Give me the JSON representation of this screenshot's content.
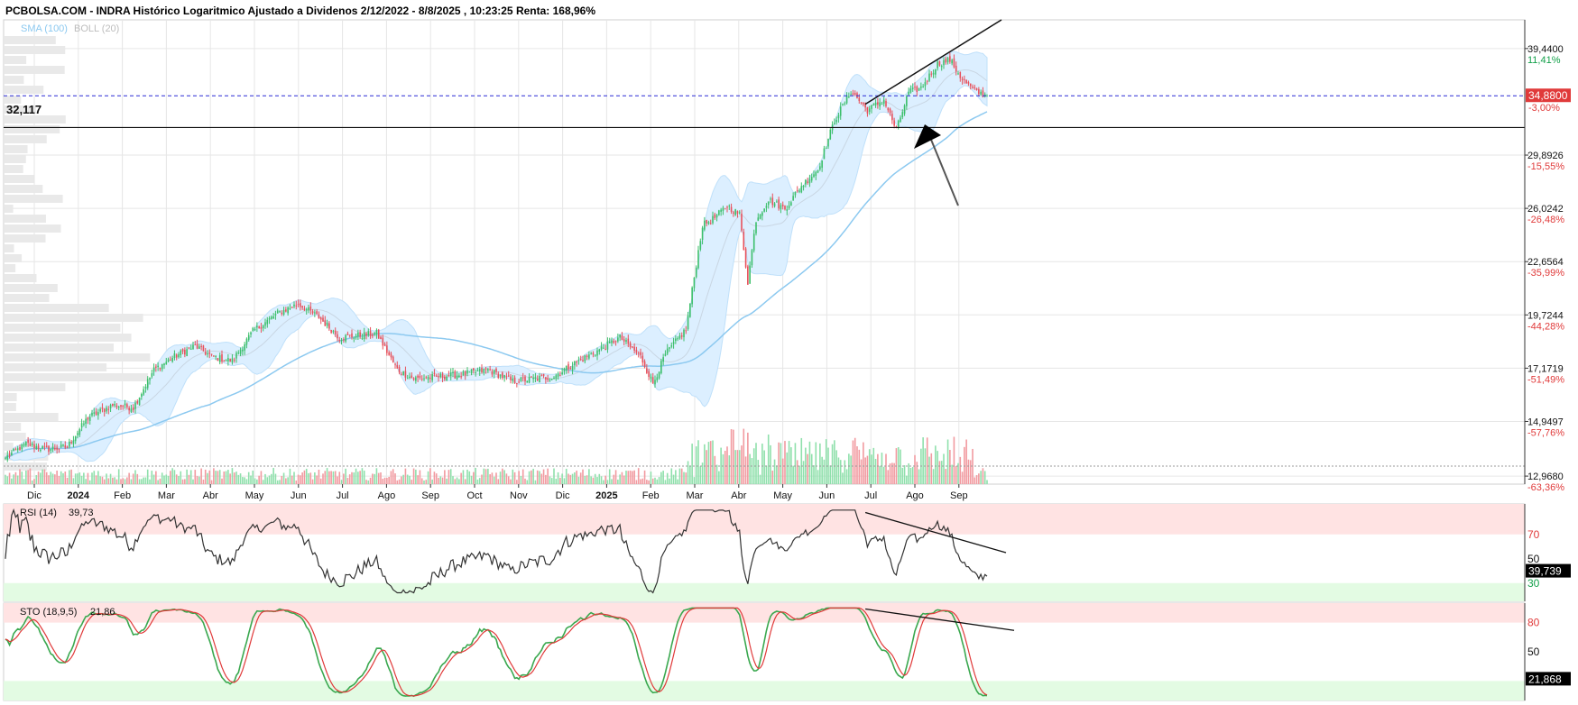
{
  "header": {
    "title": "PCBOLSA.COM - INDRA Histórico Logaritmico Ajustado a Dividenos 2/12/2022 - 8/8/2025 , 10:23:25 Renta: 168,96%"
  },
  "colors": {
    "up": "#3cbf6b",
    "down": "#e8505b",
    "vol_up": "#8fe0ac",
    "vol_down": "#f29aa0",
    "sma": "#8cc9f0",
    "boll_fill": "#dcefff",
    "grid": "#e6e6e6",
    "price_line": "#2a2ad6",
    "ob_zone": "#ffe3e3",
    "os_zone": "#e3fbe3",
    "rsi_line": "#333333",
    "sto_k": "#3aa84f",
    "sto_d": "#e03a3a",
    "red_text": "#e03a3a",
    "green_text": "#13a04a"
  },
  "legend": {
    "sma_label": "SMA (100)",
    "boll_label": "BOLL (20)"
  },
  "chart_data": {
    "type": "candlestick",
    "scale": "log",
    "price_axis": {
      "ticks": [
        {
          "value": 39.44,
          "label": "39,4400",
          "pct": "11,41%"
        },
        {
          "value": 29.8926,
          "label": "29,8926",
          "pct": "-15,55%"
        },
        {
          "value": 26.0242,
          "label": "26,0242",
          "pct": "-26,48%"
        },
        {
          "value": 22.6564,
          "label": "22,6564",
          "pct": "-35,99%"
        },
        {
          "value": 19.7244,
          "label": "19,7244",
          "pct": "-44,28%"
        },
        {
          "value": 17.1719,
          "label": "17,1719",
          "pct": "-51,49%"
        },
        {
          "value": 14.9497,
          "label": "14,9497",
          "pct": "-57,76%"
        },
        {
          "value": 12.968,
          "label": "12,9680",
          "pct": "-63,36%"
        }
      ],
      "range": [
        12.7,
        42.5
      ]
    },
    "current_price": {
      "value": 34.88,
      "label": "34,8800",
      "pct": "-3,00%"
    },
    "horizontal_level": {
      "value": 32.117,
      "label": "32,117"
    },
    "x_labels": [
      {
        "label": "Dic",
        "year": false
      },
      {
        "label": "2024",
        "year": true
      },
      {
        "label": "Feb",
        "year": false
      },
      {
        "label": "Mar",
        "year": false
      },
      {
        "label": "Abr",
        "year": false
      },
      {
        "label": "May",
        "year": false
      },
      {
        "label": "Jun",
        "year": false
      },
      {
        "label": "Jul",
        "year": false
      },
      {
        "label": "Ago",
        "year": false
      },
      {
        "label": "Sep",
        "year": false
      },
      {
        "label": "Oct",
        "year": false
      },
      {
        "label": "Nov",
        "year": false
      },
      {
        "label": "Dic",
        "year": false
      },
      {
        "label": "2025",
        "year": true
      },
      {
        "label": "Feb",
        "year": false
      },
      {
        "label": "Mar",
        "year": false
      },
      {
        "label": "Abr",
        "year": false
      },
      {
        "label": "May",
        "year": false
      },
      {
        "label": "Jun",
        "year": false
      },
      {
        "label": "Jul",
        "year": false
      },
      {
        "label": "Ago",
        "year": false
      },
      {
        "label": "Sep",
        "year": false
      }
    ],
    "close_anchors": [
      [
        0,
        13.6
      ],
      [
        10,
        14.1
      ],
      [
        20,
        13.9
      ],
      [
        30,
        14.0
      ],
      [
        40,
        15.1
      ],
      [
        52,
        15.6
      ],
      [
        62,
        15.5
      ],
      [
        72,
        17.1
      ],
      [
        82,
        17.7
      ],
      [
        92,
        18.2
      ],
      [
        100,
        17.7
      ],
      [
        110,
        17.5
      ],
      [
        120,
        18.9
      ],
      [
        132,
        19.8
      ],
      [
        142,
        20.3
      ],
      [
        152,
        19.6
      ],
      [
        162,
        18.6
      ],
      [
        172,
        18.7
      ],
      [
        180,
        18.8
      ],
      [
        190,
        17.1
      ],
      [
        198,
        16.7
      ],
      [
        210,
        16.8
      ],
      [
        222,
        16.9
      ],
      [
        234,
        17.1
      ],
      [
        246,
        16.6
      ],
      [
        256,
        16.7
      ],
      [
        266,
        16.8
      ],
      [
        276,
        17.4
      ],
      [
        286,
        17.9
      ],
      [
        298,
        18.6
      ],
      [
        308,
        17.7
      ],
      [
        314,
        16.5
      ],
      [
        320,
        17.8
      ],
      [
        330,
        19.0
      ],
      [
        338,
        24.9
      ],
      [
        344,
        25.4
      ],
      [
        350,
        26.2
      ],
      [
        356,
        25.6
      ],
      [
        360,
        21.5
      ],
      [
        364,
        25.3
      ],
      [
        370,
        26.6
      ],
      [
        378,
        26.0
      ],
      [
        386,
        27.6
      ],
      [
        394,
        28.8
      ],
      [
        402,
        32.7
      ],
      [
        410,
        35.3
      ],
      [
        418,
        33.6
      ],
      [
        426,
        34.5
      ],
      [
        432,
        31.9
      ],
      [
        438,
        35.2
      ],
      [
        444,
        35.6
      ],
      [
        452,
        37.9
      ],
      [
        458,
        38.3
      ],
      [
        464,
        36.4
      ],
      [
        470,
        35.3
      ],
      [
        476,
        34.88
      ]
    ],
    "bars": 477,
    "rsi": {
      "label": "RSI (14)",
      "value": "39,73",
      "value_box": "39,739",
      "levels": [
        {
          "value": 70,
          "label": "70"
        },
        {
          "value": 50,
          "label": "50"
        },
        {
          "value": 30,
          "label": "30"
        }
      ],
      "range": [
        15,
        95
      ]
    },
    "sto": {
      "label": "STO (18,9,5)",
      "value": "21,86",
      "value_box": "21,868",
      "levels": [
        {
          "value": 80,
          "label": "80"
        },
        {
          "value": 50,
          "label": "50"
        }
      ],
      "range": [
        0,
        100
      ]
    }
  }
}
